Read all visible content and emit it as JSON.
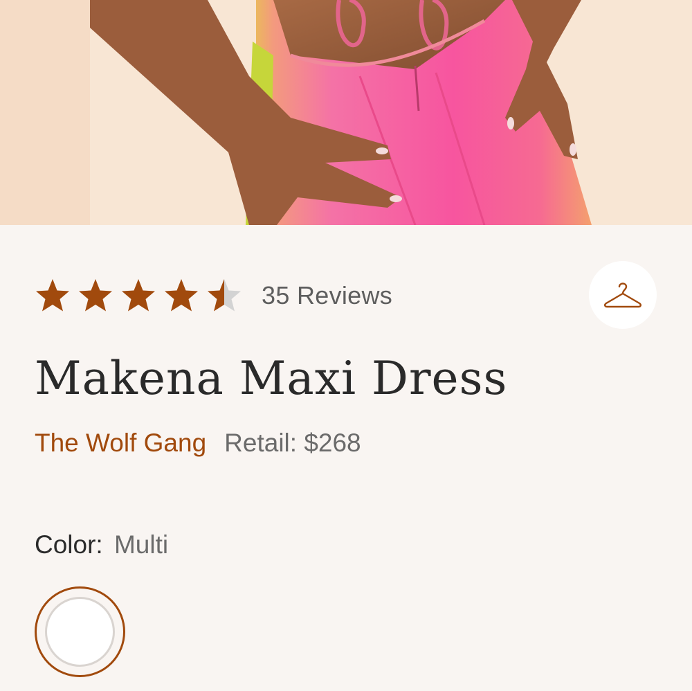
{
  "product_image": {
    "alt": ""
  },
  "rating": {
    "value": 4.5,
    "max": 5,
    "reviews_label": "35 Reviews",
    "star_color": "#a14a0d",
    "empty_star_color": "#d3d3d3"
  },
  "wishlist": {
    "icon": "hanger-icon"
  },
  "product": {
    "name": "Makena Maxi Dress",
    "brand": "The Wolf Gang",
    "retail": "Retail: $268"
  },
  "color": {
    "label": "Color:",
    "value": "Multi",
    "selected_swatch": "white-swatch"
  },
  "colors": {
    "accent": "#a14a0d",
    "background": "#f9f5f2"
  }
}
